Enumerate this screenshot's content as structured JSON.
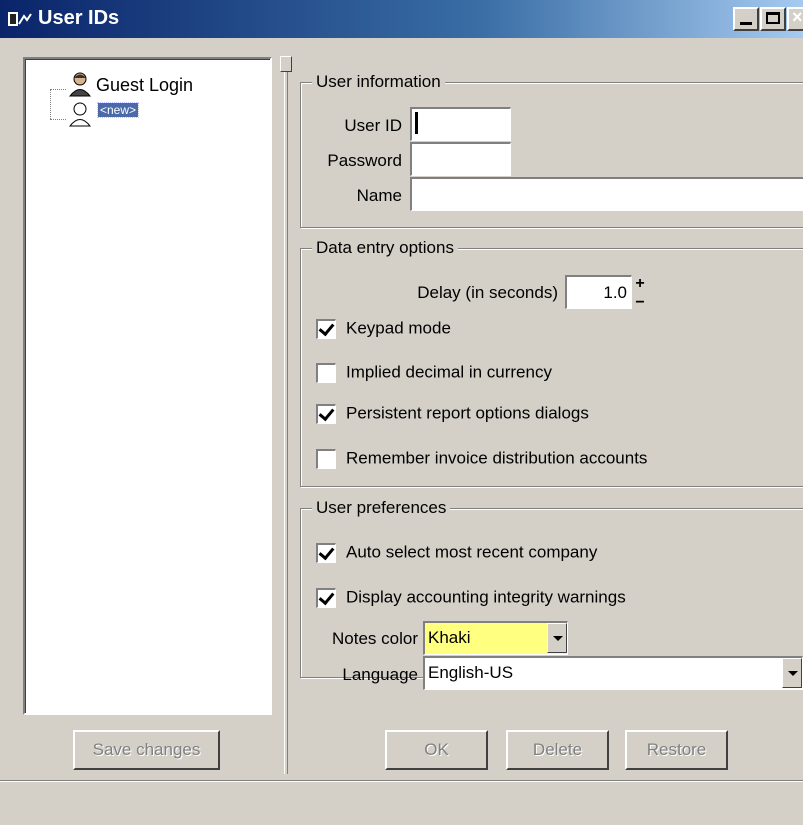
{
  "window": {
    "title": "User IDs"
  },
  "tree": {
    "items": [
      {
        "label": "Guest Login",
        "icon": "user-icon"
      },
      {
        "label": "<new>",
        "icon": "new-user-icon",
        "selected": true
      }
    ]
  },
  "user_info": {
    "legend": "User information",
    "user_id_label": "User ID",
    "user_id_value": "",
    "password_label": "Password",
    "password_value": "",
    "name_label": "Name",
    "name_value": ""
  },
  "data_entry": {
    "legend": "Data entry options",
    "delay_label": "Delay (in seconds)",
    "delay_value": "1.0",
    "checks": [
      {
        "label": "Keypad mode",
        "checked": true
      },
      {
        "label": "Implied decimal in currency",
        "checked": false
      },
      {
        "label": "Persistent report options dialogs",
        "checked": true
      },
      {
        "label": "Remember invoice distribution accounts",
        "checked": false
      }
    ]
  },
  "preferences": {
    "legend": "User preferences",
    "checks": [
      {
        "label": "Auto select most recent company",
        "checked": true
      },
      {
        "label": "Display accounting integrity warnings",
        "checked": true
      }
    ],
    "notes_color_label": "Notes color",
    "notes_color_value": "Khaki",
    "language_label": "Language",
    "language_value": "English-US"
  },
  "buttons": {
    "save": "Save changes",
    "ok": "OK",
    "delete": "Delete",
    "restore": "Restore"
  },
  "colors": {
    "window_bg": "#d4d0c8",
    "titlebar": "#0a246a",
    "selection": "#4a6aa8",
    "notes_color": "#ffff80"
  }
}
